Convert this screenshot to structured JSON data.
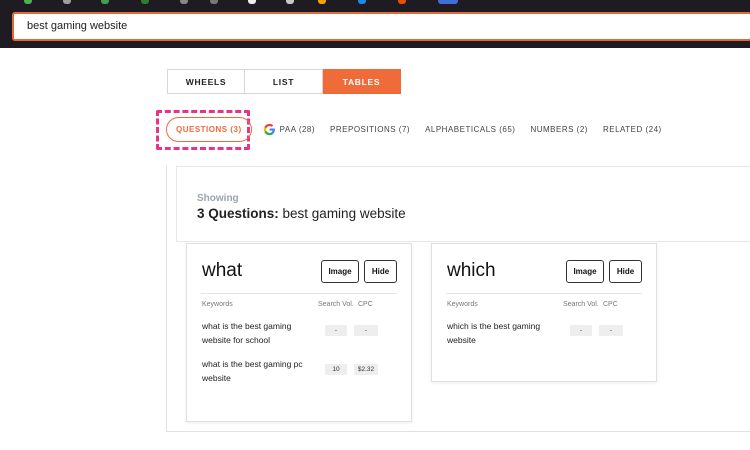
{
  "search": {
    "value": "best gaming website"
  },
  "view_tabs": [
    {
      "label": "WHEELS"
    },
    {
      "label": "LIST"
    },
    {
      "label": "TABLES"
    }
  ],
  "sub_tabs": [
    {
      "label": "QUESTIONS (3)"
    },
    {
      "label": "PAA (28)"
    },
    {
      "label": "PREPOSITIONS (7)"
    },
    {
      "label": "ALPHABETICALS (65)"
    },
    {
      "label": "NUMBERS (2)"
    },
    {
      "label": "RELATED (24)"
    }
  ],
  "showing": {
    "label": "Showing",
    "count_label": "3 Questions:",
    "query": "best gaming website"
  },
  "cards": [
    {
      "title": "what",
      "image_label": "Image",
      "hide_label": "Hide",
      "col_keywords": "Keywords",
      "col_search_vol": "Search Vol.",
      "col_cpc": "CPC",
      "rows": [
        {
          "keyword": "what is the best gaming website for school",
          "search_vol": "-",
          "cpc": "-"
        },
        {
          "keyword": "what is the best gaming pc website",
          "search_vol": "10",
          "cpc": "$2.32"
        }
      ]
    },
    {
      "title": "which",
      "image_label": "Image",
      "hide_label": "Hide",
      "col_keywords": "Keywords",
      "col_search_vol": "Search Vol.",
      "col_cpc": "CPC",
      "rows": [
        {
          "keyword": "which is the best gaming website",
          "search_vol": "-",
          "cpc": "-"
        }
      ]
    }
  ],
  "colors": {
    "accent": "#ef6c3a",
    "highlight": "#e8338a",
    "topbar": "#1e1c22"
  }
}
